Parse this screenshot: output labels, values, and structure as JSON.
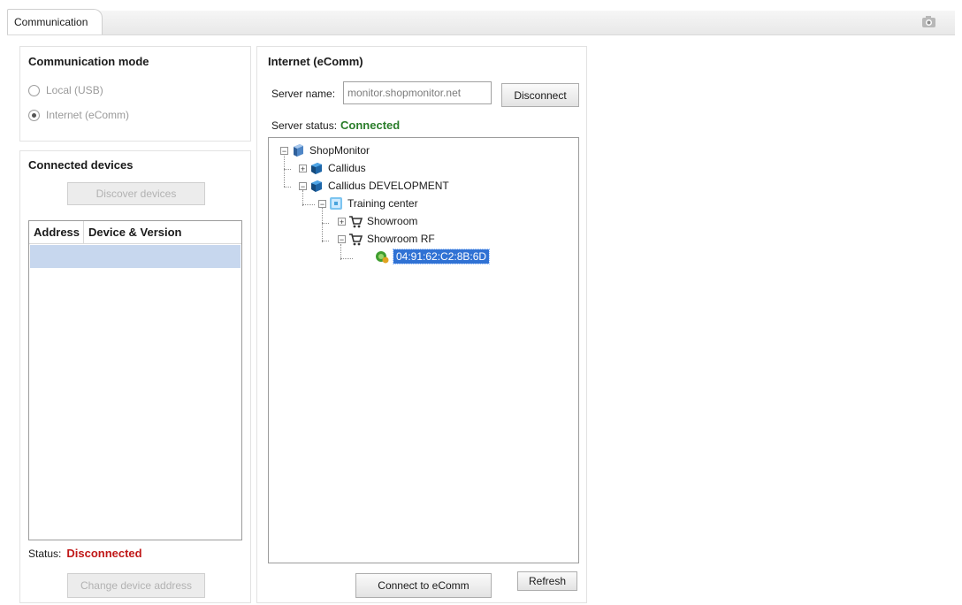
{
  "tab": {
    "label": "Communication"
  },
  "mode_panel": {
    "title": "Communication mode",
    "options": [
      {
        "label": "Local (USB)"
      },
      {
        "label": "Internet (eComm)"
      }
    ]
  },
  "devices_panel": {
    "title": "Connected devices",
    "discover_label": "Discover devices",
    "columns": [
      "Address",
      "Device & Version"
    ],
    "status_label": "Status:",
    "status_value": "Disconnected",
    "change_address_label": "Change device address"
  },
  "internet_panel": {
    "title": "Internet (eComm)",
    "server_label": "Server name:",
    "server_value": "monitor.shopmonitor.net",
    "disconnect_label": "Disconnect",
    "status_label": "Server status:",
    "status_value": "Connected",
    "tree": [
      {
        "label": "ShopMonitor"
      },
      {
        "label": "Callidus"
      },
      {
        "label": "Callidus DEVELOPMENT"
      },
      {
        "label": "Training center"
      },
      {
        "label": "Showroom"
      },
      {
        "label": "Showroom RF"
      },
      {
        "label": "04:91:62:C2:8B:6D"
      }
    ],
    "connect_label": "Connect to eComm",
    "refresh_label": "Refresh"
  },
  "colors": {
    "selection": "#3072d4",
    "connected": "#2a7d2a",
    "disconnected": "#c01818"
  }
}
